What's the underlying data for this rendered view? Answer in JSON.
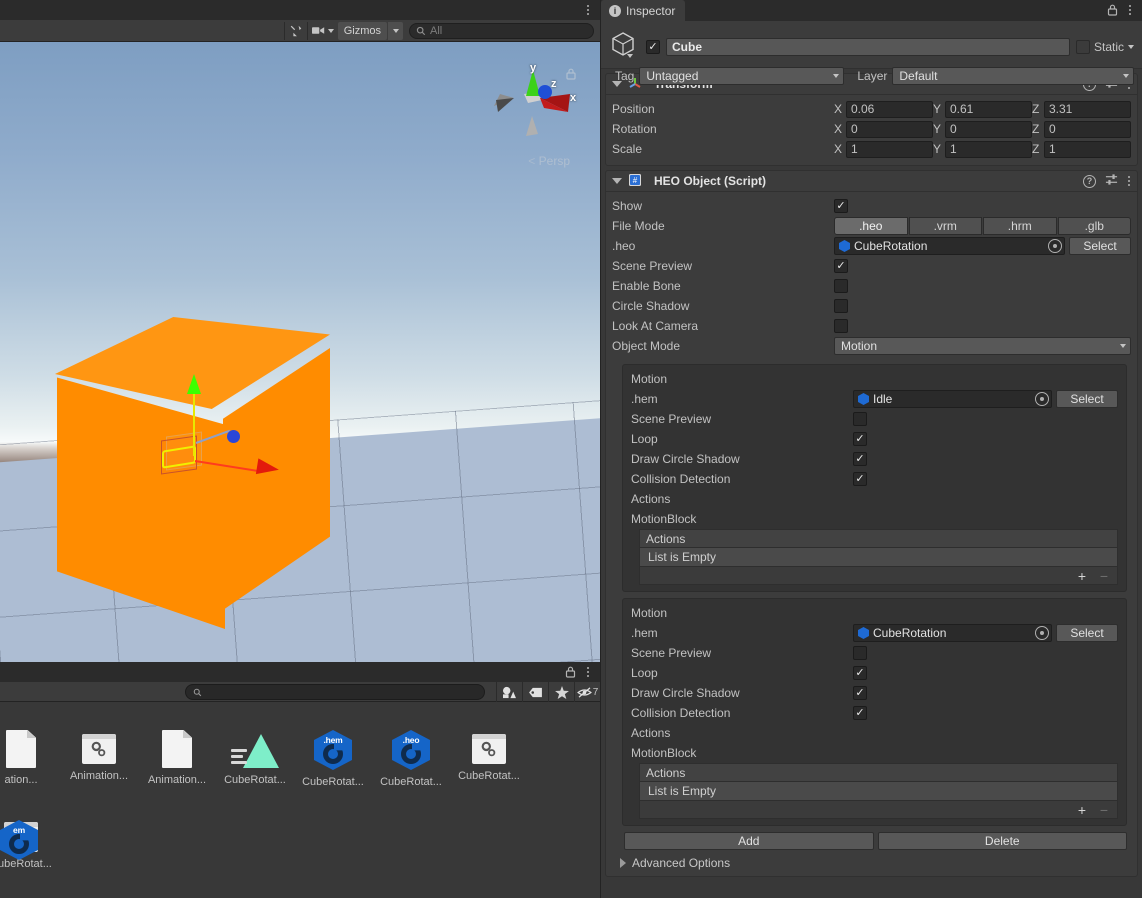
{
  "scene_view": {
    "toolbar": {
      "tools_icon": "tools-icon",
      "camera_icon": "camera-icon",
      "gizmos_label": "Gizmos",
      "search_placeholder": "All",
      "search_icon": "search-icon"
    },
    "orientation_gizmo": {
      "x_label": "x",
      "y_label": "y",
      "z_label": "z",
      "projection_label": "Persp",
      "lock_icon": "lock-icon"
    },
    "colors": {
      "cube": "#ff8c00",
      "axis_x": "#e31a0c",
      "axis_y": "#3cff00",
      "axis_z": "#2a46d8",
      "sky_top": "#7e9ec2",
      "ground": "#8a7770",
      "plane": "#adbdd3"
    }
  },
  "project_panel": {
    "search_placeholder": "",
    "search_icon": "search-icon",
    "lock_icon": "lock-icon",
    "filters": [
      {
        "name": "type-filter-icon",
        "label": ""
      },
      {
        "name": "label-filter-icon",
        "label": ""
      },
      {
        "name": "favorites-star-icon",
        "label": ""
      },
      {
        "name": "hidden-items-icon",
        "label": "7"
      }
    ],
    "assets": [
      {
        "label": "ation...",
        "icon": "document-icon"
      },
      {
        "label": "Animation...",
        "icon": "script-icon"
      },
      {
        "label": "Animation...",
        "icon": "document-icon"
      },
      {
        "label": "CubeRotat...",
        "icon": "animation-clip-icon"
      },
      {
        "label": "CubeRotat...",
        "icon": "hem-file-icon",
        "ext": ".hem"
      },
      {
        "label": "CubeRotat...",
        "icon": "heo-file-icon",
        "ext": ".heo"
      },
      {
        "label": "CubeRotat...",
        "icon": "script-icon"
      },
      {
        "label": "CubeRotat...",
        "icon": "script-icon"
      }
    ],
    "assets_row2": [
      {
        "label": "",
        "icon": "hem-file-icon",
        "ext": "em"
      }
    ]
  },
  "inspector": {
    "tab_label": "Inspector",
    "tab_icon": "info-icon",
    "lock_icon": "lock-icon",
    "menu_icon": "kebab-menu-icon",
    "game_object": {
      "icon": "cube-gameobject-icon",
      "enabled": true,
      "name": "Cube",
      "static_label": "Static",
      "static_checked": false,
      "tag_label": "Tag",
      "tag_value": "Untagged",
      "layer_label": "Layer",
      "layer_value": "Default"
    },
    "transform": {
      "title": "Transform",
      "icon": "transform-axes-icon",
      "rows": [
        {
          "label": "Position",
          "x": "0.06",
          "y": "0.61",
          "z": "3.31"
        },
        {
          "label": "Rotation",
          "x": "0",
          "y": "0",
          "z": "0"
        },
        {
          "label": "Scale",
          "x": "1",
          "y": "1",
          "z": "1"
        }
      ],
      "axis_labels": {
        "x": "X",
        "y": "Y",
        "z": "Z"
      }
    },
    "heo_object": {
      "title": "HEO Object (Script)",
      "icon": "cs-script-icon",
      "show_label": "Show",
      "show_checked": true,
      "file_mode_label": "File Mode",
      "file_modes": [
        ".heo",
        ".vrm",
        ".hrm",
        ".glb"
      ],
      "file_mode_selected": ".heo",
      "heo_label": ".heo",
      "heo_value": "CubeRotation",
      "heo_select_label": "Select",
      "scene_preview_label": "Scene Preview",
      "scene_preview_checked": true,
      "enable_bone_label": "Enable Bone",
      "enable_bone_checked": false,
      "circle_shadow_label": "Circle Shadow",
      "circle_shadow_checked": false,
      "look_at_camera_label": "Look At Camera",
      "look_at_camera_checked": false,
      "object_mode_label": "Object Mode",
      "object_mode_value": "Motion",
      "motions": [
        {
          "header": "Motion",
          "hem_label": ".hem",
          "hem_value": "Idle",
          "select_label": "Select",
          "scene_preview_label": "Scene Preview",
          "scene_preview_checked": false,
          "loop_label": "Loop",
          "loop_checked": true,
          "draw_circle_shadow_label": "Draw Circle Shadow",
          "draw_circle_shadow_checked": true,
          "collision_detection_label": "Collision Detection",
          "collision_detection_checked": true,
          "actions_label": "Actions",
          "motion_block_label": "MotionBlock",
          "list_header": "Actions",
          "list_empty_text": "List is Empty",
          "add_item_label": "+",
          "remove_item_label": "−"
        },
        {
          "header": "Motion",
          "hem_label": ".hem",
          "hem_value": "CubeRotation",
          "select_label": "Select",
          "scene_preview_label": "Scene Preview",
          "scene_preview_checked": false,
          "loop_label": "Loop",
          "loop_checked": true,
          "draw_circle_shadow_label": "Draw Circle Shadow",
          "draw_circle_shadow_checked": true,
          "collision_detection_label": "Collision Detection",
          "collision_detection_checked": true,
          "actions_label": "Actions",
          "motion_block_label": "MotionBlock",
          "list_header": "Actions",
          "list_empty_text": "List is Empty",
          "add_item_label": "+",
          "remove_item_label": "−"
        }
      ],
      "add_button": "Add",
      "delete_button": "Delete",
      "advanced_options_label": "Advanced Options"
    }
  }
}
